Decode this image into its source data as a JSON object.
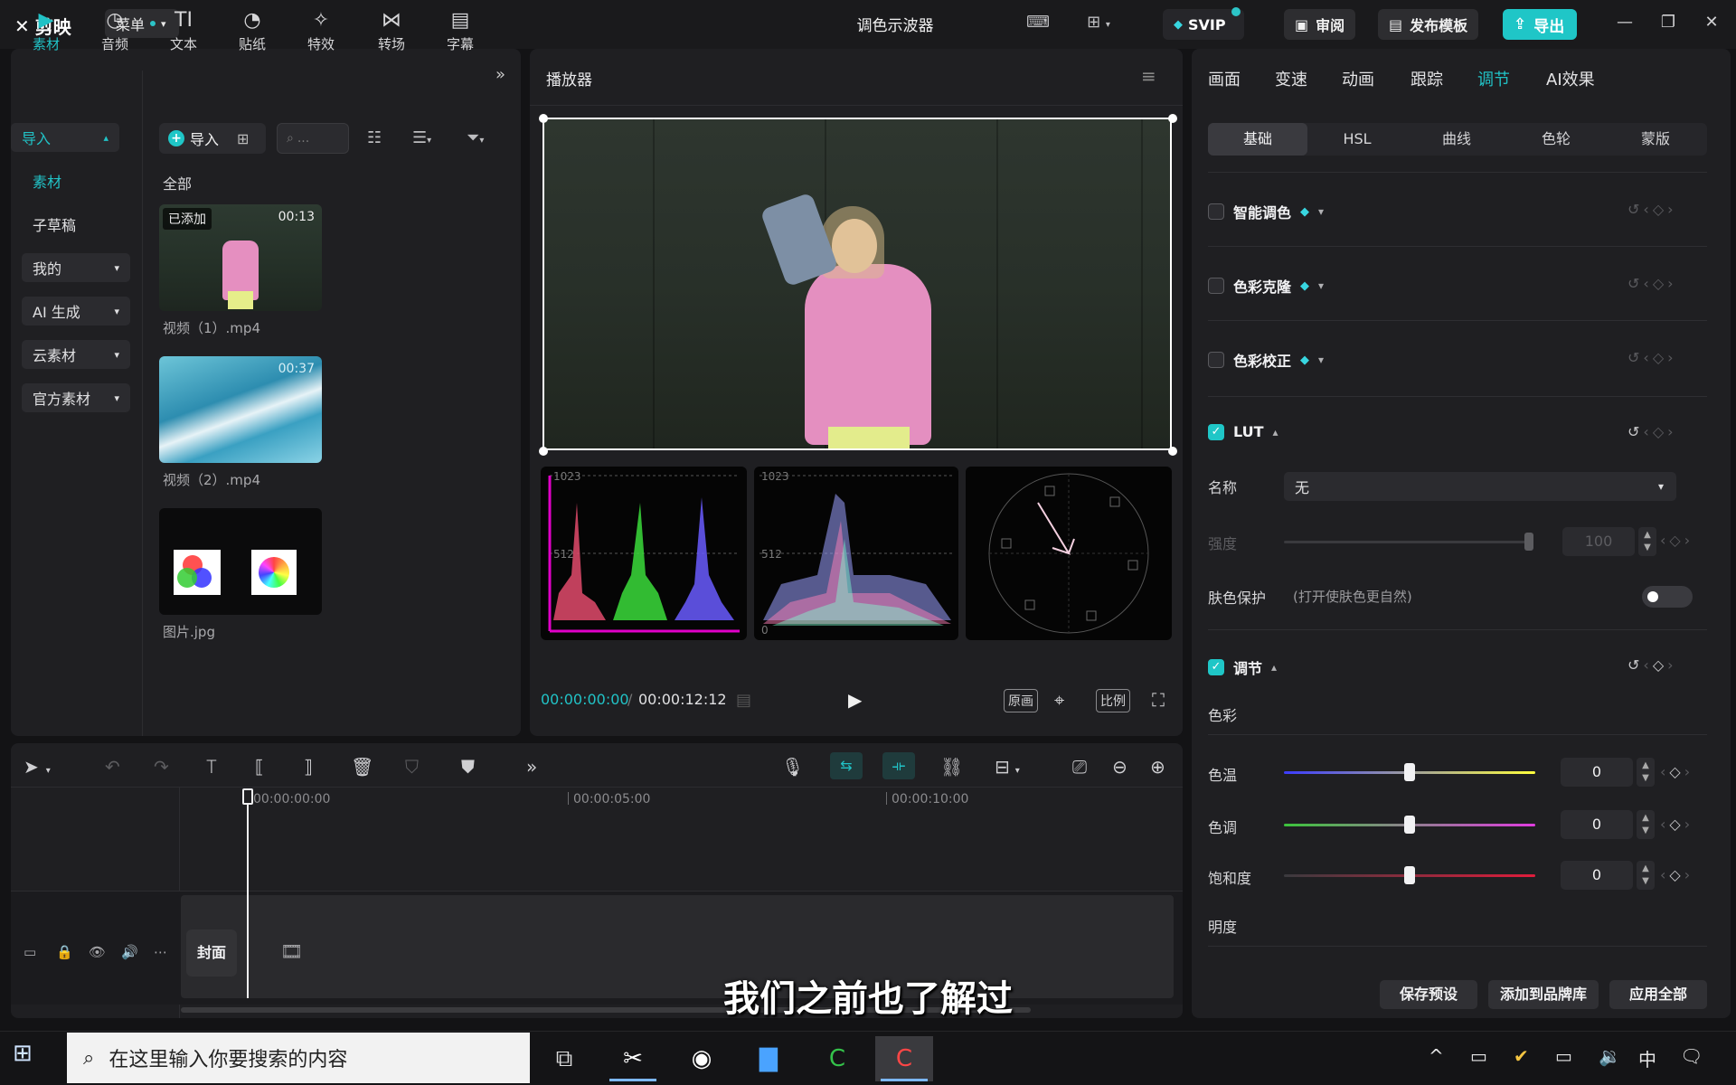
{
  "app": {
    "logo_text": "剪映",
    "menu_label": "菜单",
    "window_title": "调色示波器",
    "svip_label": "SVIP",
    "review_label": "审阅",
    "publish_label": "发布模板",
    "export_label": "导出"
  },
  "media": {
    "tabs": [
      {
        "label": "素材",
        "icon": "▶"
      },
      {
        "label": "音频",
        "icon": "◷"
      },
      {
        "label": "文本",
        "icon": "TI"
      },
      {
        "label": "贴纸",
        "icon": "◔"
      },
      {
        "label": "特效",
        "icon": "✧"
      },
      {
        "label": "转场",
        "icon": "⋈"
      },
      {
        "label": "字幕",
        "icon": "▤"
      }
    ],
    "sidebar": {
      "import": "导入",
      "material": "素材",
      "sub_draft": "子草稿",
      "mine": "我的",
      "ai_generate": "AI 生成",
      "cloud": "云素材",
      "official": "官方素材"
    },
    "import_button": "导入",
    "search_placeholder": "...",
    "all_label": "全部",
    "items": [
      {
        "name": "视频（1）.mp4",
        "badge": "已添加",
        "duration": "00:13"
      },
      {
        "name": "视频（2）.mp4",
        "duration": "00:37"
      },
      {
        "name": "图片.jpg"
      }
    ]
  },
  "player": {
    "title": "播放器",
    "scope_labels": {
      "top": "1023",
      "mid": "512",
      "bottom": "0"
    },
    "timecode_current": "00:00:00:00",
    "timecode_separator": "/",
    "timecode_total": "00:00:12:12",
    "original_label": "原画",
    "ratio_label": "比例"
  },
  "inspector": {
    "tabs": [
      "画面",
      "变速",
      "动画",
      "跟踪",
      "调节",
      "AI效果"
    ],
    "active_tab": "调节",
    "sub_tabs": [
      "基础",
      "HSL",
      "曲线",
      "色轮",
      "蒙版"
    ],
    "sections": {
      "smart_color": "智能调色",
      "color_clone": "色彩克隆",
      "color_correct": "色彩校正",
      "lut": "LUT",
      "adjust": "调节"
    },
    "lut": {
      "name_label": "名称",
      "name_value": "无",
      "intensity_label": "强度",
      "intensity_value": "100",
      "skin_protect_label": "肤色保护",
      "skin_protect_hint": "(打开使肤色更自然)"
    },
    "adjust": {
      "color_group": "色彩",
      "brightness_group": "明度",
      "sliders": [
        {
          "label": "色温",
          "value": "0",
          "level": 0.5
        },
        {
          "label": "色调",
          "value": "0",
          "level": 0.5
        },
        {
          "label": "饱和度",
          "value": "0",
          "level": 0.5
        }
      ]
    },
    "footer": {
      "save_preset": "保存预设",
      "add_brand": "添加到品牌库",
      "apply_all": "应用全部"
    }
  },
  "timeline": {
    "ticks": [
      "00:00:00:00",
      "00:00:05:00",
      "00:00:10:00"
    ],
    "cover_label": "封面"
  },
  "subtitle_overlay": "我们之前也了解过",
  "taskbar": {
    "search_placeholder": "在这里输入你要搜索的内容",
    "ime_label": "中"
  }
}
